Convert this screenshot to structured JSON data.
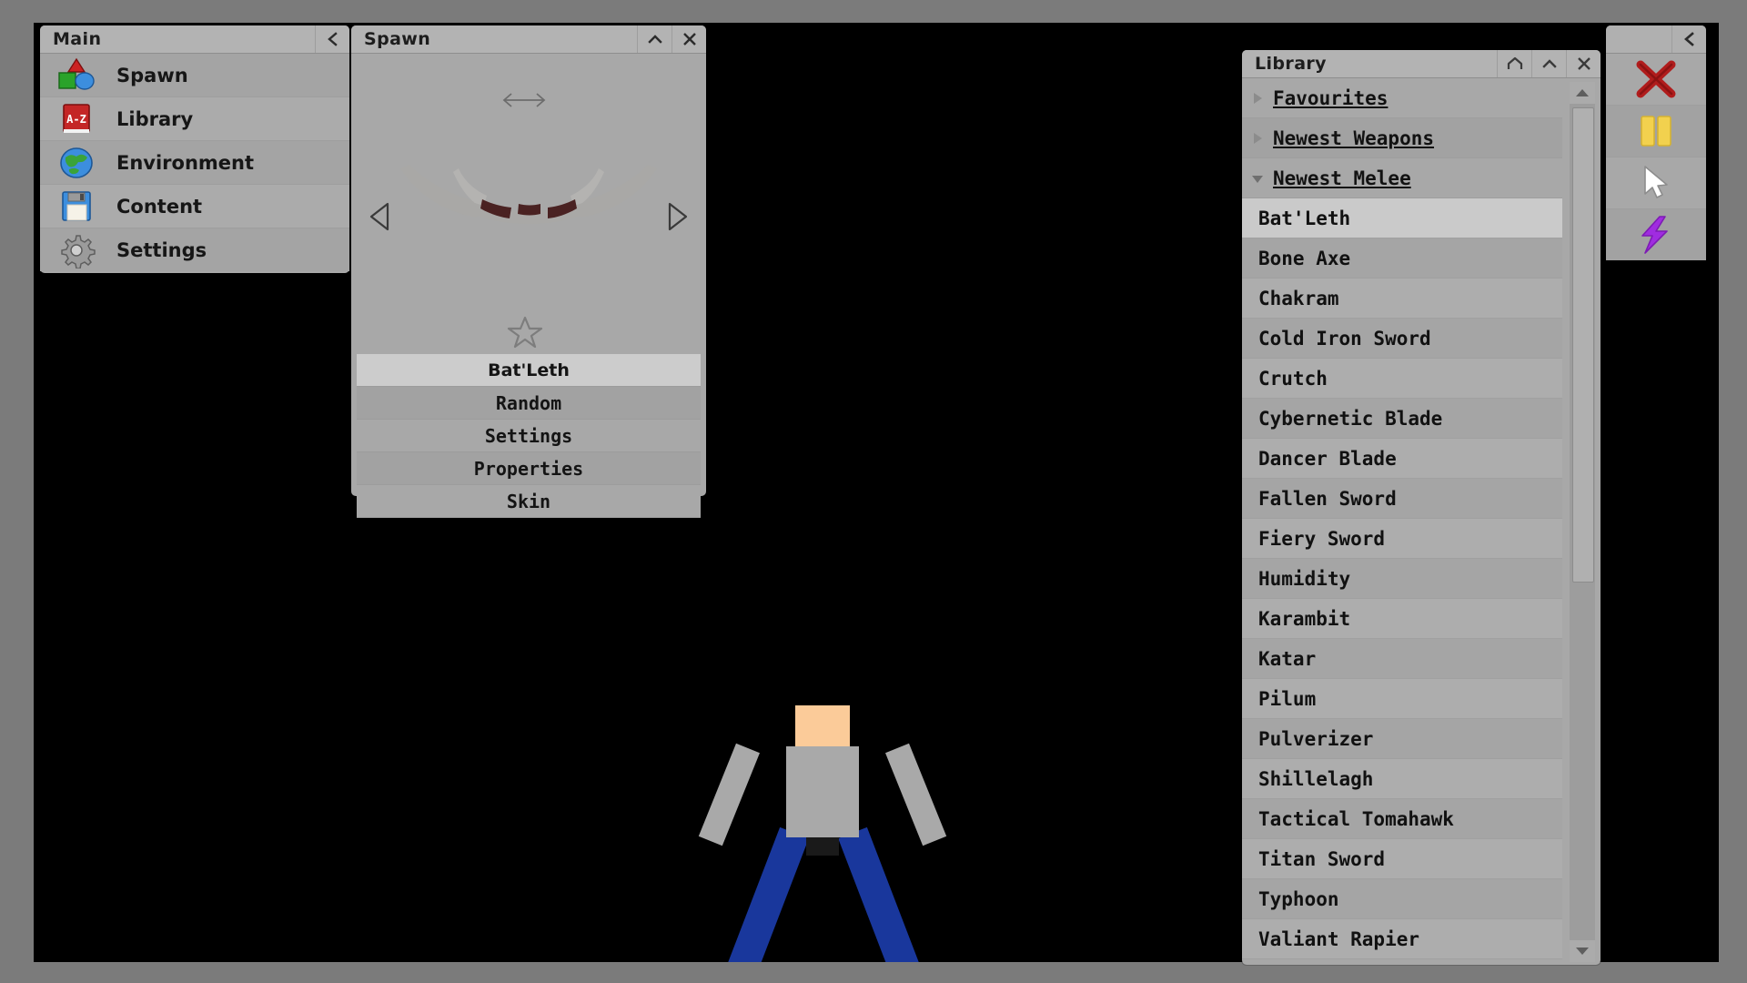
{
  "app": {
    "background_color": "#000000",
    "frame_color": "#7b7b7b"
  },
  "main_panel": {
    "title": "Main",
    "collapse_icon": "chevron-left-icon",
    "items": [
      {
        "label": "Spawn",
        "icon": "shapes-icon"
      },
      {
        "label": "Library",
        "icon": "book-a-z-icon"
      },
      {
        "label": "Environment",
        "icon": "globe-icon"
      },
      {
        "label": "Content",
        "icon": "floppy-disk-icon"
      },
      {
        "label": "Settings",
        "icon": "gear-icon"
      }
    ]
  },
  "spawn_panel": {
    "title": "Spawn",
    "collapse_icon": "chevron-up-icon",
    "close_icon": "close-x-icon",
    "resize_icon": "horizontal-resize-arrow-icon",
    "prev_icon": "triangle-left-icon",
    "next_icon": "triangle-right-icon",
    "favourite_icon": "star-outline-icon",
    "preview_item": "Bat'Leth",
    "buttons": [
      {
        "label": "Bat'Leth",
        "selected": true
      },
      {
        "label": "Random",
        "selected": false
      },
      {
        "label": "Settings",
        "selected": false
      },
      {
        "label": "Properties",
        "selected": false
      },
      {
        "label": "Skin",
        "selected": false
      }
    ],
    "weapon_colors": {
      "blade": "#a9a8a6",
      "grip": "#4a2222"
    }
  },
  "library_panel": {
    "title": "Library",
    "home_icon": "home-icon",
    "collapse_icon": "chevron-up-icon",
    "close_icon": "close-x-icon",
    "scroll_up_icon": "scroll-up-arrow-icon",
    "scroll_down_icon": "scroll-down-arrow-icon",
    "categories": [
      {
        "label": "Favourites",
        "expanded": false,
        "icon": "triangle-right-icon"
      },
      {
        "label": "Newest Weapons",
        "expanded": false,
        "icon": "triangle-right-icon"
      },
      {
        "label": "Newest Melee",
        "expanded": true,
        "icon": "triangle-down-icon"
      }
    ],
    "items": [
      {
        "label": "Bat'Leth",
        "selected": true
      },
      {
        "label": "Bone Axe",
        "selected": false
      },
      {
        "label": "Chakram",
        "selected": false
      },
      {
        "label": "Cold Iron Sword",
        "selected": false
      },
      {
        "label": "Crutch",
        "selected": false
      },
      {
        "label": "Cybernetic Blade",
        "selected": false
      },
      {
        "label": "Dancer Blade",
        "selected": false
      },
      {
        "label": "Fallen Sword",
        "selected": false
      },
      {
        "label": "Fiery Sword",
        "selected": false
      },
      {
        "label": "Humidity",
        "selected": false
      },
      {
        "label": "Karambit",
        "selected": false
      },
      {
        "label": "Katar",
        "selected": false
      },
      {
        "label": "Pilum",
        "selected": false
      },
      {
        "label": "Pulverizer",
        "selected": false
      },
      {
        "label": "Shillelagh",
        "selected": false
      },
      {
        "label": "Tactical Tomahawk",
        "selected": false
      },
      {
        "label": "Titan Sword",
        "selected": false
      },
      {
        "label": "Typhoon",
        "selected": false
      },
      {
        "label": "Valiant Rapier",
        "selected": false
      }
    ]
  },
  "tool_palette": {
    "collapse_icon": "chevron-left-icon",
    "tools": [
      {
        "name": "delete-tool",
        "icon": "red-x-icon",
        "color": "#b01c1c"
      },
      {
        "name": "pause-tool",
        "icon": "yellow-pause-icon",
        "color": "#f2d14e"
      },
      {
        "name": "select-tool",
        "icon": "white-cursor-icon",
        "color": "#ffffff"
      },
      {
        "name": "force-tool",
        "icon": "purple-lightning-icon",
        "color": "#a02ce0"
      }
    ]
  }
}
